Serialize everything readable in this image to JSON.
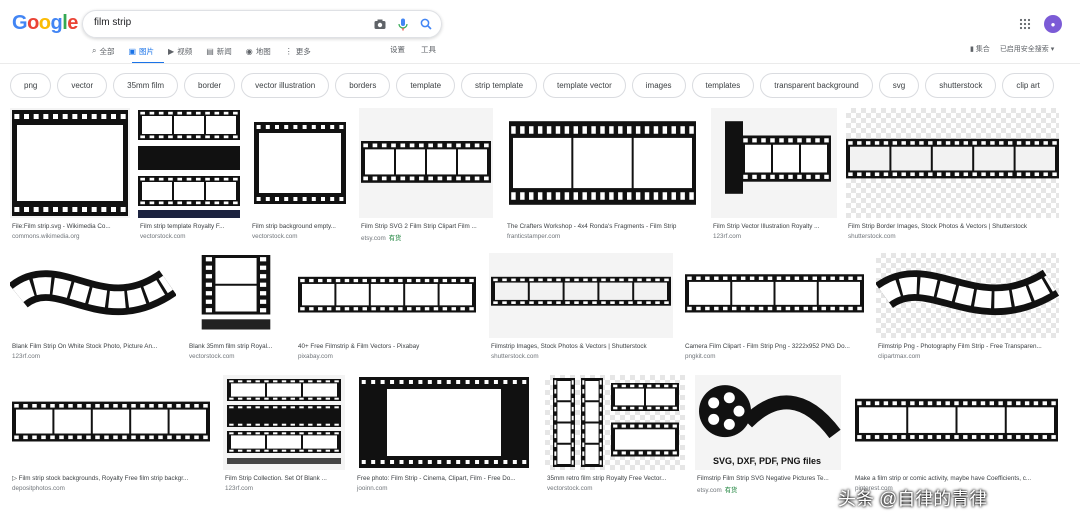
{
  "header": {
    "logo_letters": [
      "G",
      "o",
      "o",
      "g",
      "l",
      "e"
    ],
    "search_value": "film strip",
    "icons": [
      "camera-icon",
      "mic-icon",
      "search-icon"
    ],
    "apps_icon": "grid-apps-icon",
    "avatar_text": "●"
  },
  "tabs": [
    {
      "label": "全部",
      "icon": "⌕",
      "active": false
    },
    {
      "label": "图片",
      "icon": "▣",
      "active": true
    },
    {
      "label": "视频",
      "icon": "▶",
      "active": false
    },
    {
      "label": "新闻",
      "icon": "▤",
      "active": false
    },
    {
      "label": "地图",
      "icon": "◉",
      "active": false
    },
    {
      "label": "更多",
      "icon": "⋮",
      "active": false
    }
  ],
  "tools": {
    "settings": "设置",
    "tools": "工具"
  },
  "right_tools": {
    "collections": "集合",
    "safe_search": "已启用安全搜索 ▾"
  },
  "chips": [
    "png",
    "vector",
    "35mm film",
    "border",
    "vector illustration",
    "borders",
    "template",
    "strip template",
    "template vector",
    "images",
    "templates",
    "transparent background",
    "svg",
    "shutterstock",
    "clip art"
  ],
  "results": [
    {
      "caption": "File:Film strip.svg - Wikimedia Co...",
      "source": "commons.wikimedia.org",
      "tag": ""
    },
    {
      "caption": "Film strip template Royalty F...",
      "source": "vectorstock.com",
      "tag": ""
    },
    {
      "caption": "Film strip background empty...",
      "source": "vectorstock.com",
      "tag": ""
    },
    {
      "caption": "Film Strip SVG 2 Film Strip Clipart Film ...",
      "source": "etsy.com",
      "tag": "有货"
    },
    {
      "caption": "The Crafters Workshop - 4x4 Ronda's Fragments - Film Strip",
      "source": "franticstamper.com",
      "tag": ""
    },
    {
      "caption": "Film Strip Vector Illustration Royalty ...",
      "source": "123rf.com",
      "tag": ""
    },
    {
      "caption": "Film Strip Border Images, Stock Photos & Vectors | Shutterstock",
      "source": "shutterstock.com",
      "tag": ""
    },
    {
      "caption": "Blank Film Strip On White Stock Photo, Picture An...",
      "source": "123rf.com",
      "tag": ""
    },
    {
      "caption": "Blank 35mm film strip Royal...",
      "source": "vectorstock.com",
      "tag": ""
    },
    {
      "caption": "40+ Free Filmstrip & Film Vectors - Pixabay",
      "source": "pixabay.com",
      "tag": ""
    },
    {
      "caption": "Filmstrip Images, Stock Photos & Vectors | Shutterstock",
      "source": "shutterstock.com",
      "tag": ""
    },
    {
      "caption": "Camera Film Clipart - Film Strip Png - 3222x952 PNG Do...",
      "source": "pngkit.com",
      "tag": ""
    },
    {
      "caption": "Filmstrip Png - Photography Film Strip - Free Transparen...",
      "source": "clipartmax.com",
      "tag": ""
    },
    {
      "caption": "▷ Film strip stock backgrounds, Royalty Free film strip backgr...",
      "source": "depositphotos.com",
      "tag": ""
    },
    {
      "caption": "Film Strip Collection. Set Of Blank ...",
      "source": "123rf.com",
      "tag": ""
    },
    {
      "caption": "Free photo: Film Strip - Cinema, Clipart, Film - Free Do...",
      "source": "jooinn.com",
      "tag": ""
    },
    {
      "caption": "35mm retro film strip Royalty Free Vector...",
      "source": "vectorstock.com",
      "tag": ""
    },
    {
      "caption": "Filmstrip Film Strip SVG Negative Pictures Te...",
      "source": "etsy.com",
      "tag": "有货"
    },
    {
      "caption": "Make a film strip or comic activity, maybe have Coefficients, c...",
      "source": "pinterest.com",
      "tag": ""
    }
  ],
  "thumb_texts": {
    "svg_formats": "SVG, DXF, PDF, PNG files"
  },
  "watermark": "头条 @自律的青律"
}
